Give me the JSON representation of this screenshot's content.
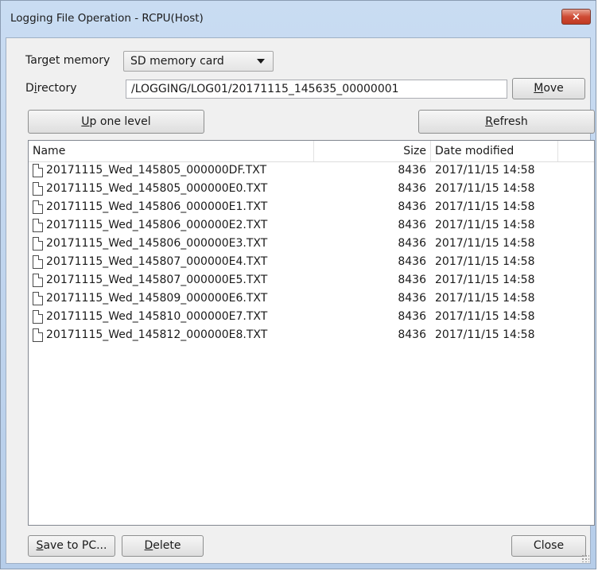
{
  "window": {
    "title": "Logging File Operation - RCPU(Host)",
    "close_glyph": "×"
  },
  "target_memory": {
    "label_pre": "Tar",
    "label_key": "g",
    "label_post": "et memory",
    "selected": "SD memory card"
  },
  "directory": {
    "label_pre": "D",
    "label_key": "i",
    "label_post": "rectory",
    "value": "/LOGGING/LOG01/20171115_145635_00000001"
  },
  "buttons": {
    "move": {
      "key": "M",
      "rest": "ove"
    },
    "up_one_level": {
      "key": "U",
      "rest": "p one level"
    },
    "refresh": {
      "key": "R",
      "rest": "efresh"
    },
    "save_to_pc": {
      "key": "S",
      "rest": "ave to PC..."
    },
    "delete": {
      "key": "D",
      "rest": "elete"
    },
    "close": "Close"
  },
  "list": {
    "columns": {
      "name": "Name",
      "size": "Size",
      "date": "Date modified"
    },
    "rows": [
      {
        "name": "20171115_Wed_145805_000000DF.TXT",
        "size": "8436",
        "date": "2017/11/15 14:58"
      },
      {
        "name": "20171115_Wed_145805_000000E0.TXT",
        "size": "8436",
        "date": "2017/11/15 14:58"
      },
      {
        "name": "20171115_Wed_145806_000000E1.TXT",
        "size": "8436",
        "date": "2017/11/15 14:58"
      },
      {
        "name": "20171115_Wed_145806_000000E2.TXT",
        "size": "8436",
        "date": "2017/11/15 14:58"
      },
      {
        "name": "20171115_Wed_145806_000000E3.TXT",
        "size": "8436",
        "date": "2017/11/15 14:58"
      },
      {
        "name": "20171115_Wed_145807_000000E4.TXT",
        "size": "8436",
        "date": "2017/11/15 14:58"
      },
      {
        "name": "20171115_Wed_145807_000000E5.TXT",
        "size": "8436",
        "date": "2017/11/15 14:58"
      },
      {
        "name": "20171115_Wed_145809_000000E6.TXT",
        "size": "8436",
        "date": "2017/11/15 14:58"
      },
      {
        "name": "20171115_Wed_145810_000000E7.TXT",
        "size": "8436",
        "date": "2017/11/15 14:58"
      },
      {
        "name": "20171115_Wed_145812_000000E8.TXT",
        "size": "8436",
        "date": "2017/11/15 14:58"
      }
    ]
  },
  "icons": {
    "file": "file-icon",
    "dropdown": "chevron-down-icon",
    "close": "close-icon"
  }
}
